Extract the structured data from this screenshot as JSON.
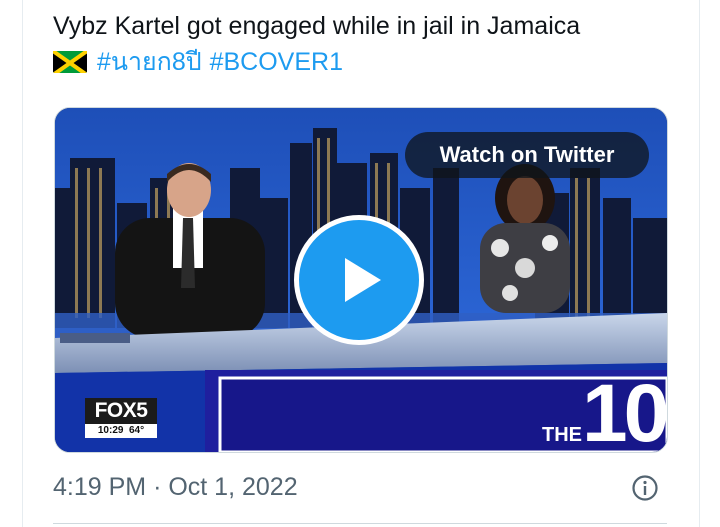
{
  "tweet": {
    "text_line1": "Vybz Kartel got engaged while in jail in Jamaica",
    "flag_icon": "jamaica-flag-icon",
    "hashtags": [
      "#นายก8ปี",
      "#BCOVER1"
    ]
  },
  "media": {
    "watch_label": "Watch on Twitter",
    "play_icon": "play-icon",
    "channel_logo": "FOX5",
    "logo_time": "10:29",
    "logo_temp": "64°",
    "show_the": "THE",
    "show_number": "10"
  },
  "meta": {
    "time": "4:19 PM",
    "separator": "·",
    "date": "Oct 1, 2022",
    "info_icon": "info-icon"
  },
  "colors": {
    "link": "#1d9bf0",
    "text": "#0f1419",
    "secondary": "#536471",
    "play": "#1d9bf0"
  }
}
